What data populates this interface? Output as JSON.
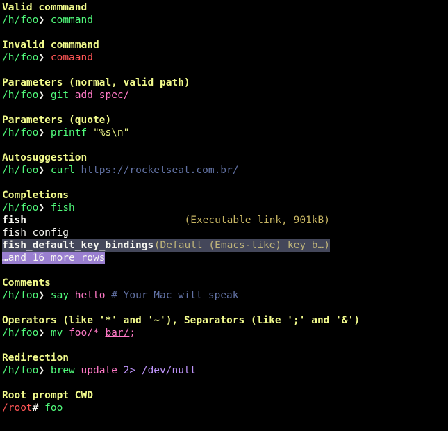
{
  "sections": {
    "valid": {
      "title": "Valid commmand",
      "cwd": "/h/foo",
      "prompt": "❯",
      "command": "command"
    },
    "invalid": {
      "title": "Invalid commmand",
      "cwd": "/h/foo",
      "prompt": "❯",
      "command": "comaand"
    },
    "params": {
      "title": "Parameters (normal, valid path)",
      "cwd": "/h/foo",
      "prompt": "❯",
      "command": "git",
      "arg1": "add",
      "path": "spec/"
    },
    "quote": {
      "title": "Parameters (quote)",
      "cwd": "/h/foo",
      "prompt": "❯",
      "command": "printf",
      "arg": "\"%s\\n\""
    },
    "autosuggestion": {
      "title": "Autosuggestion",
      "cwd": "/h/foo",
      "prompt": "❯",
      "command": "curl",
      "suggestion": "https://rocketseat.com.br/"
    },
    "completions": {
      "title": "Completions",
      "cwd": "/h/foo",
      "prompt": "❯",
      "command": "fish",
      "items": [
        {
          "name": "fish",
          "desc": "(Executable link, 901kB)"
        },
        {
          "name": "fish_config",
          "desc": ""
        },
        {
          "name": "fish_default_key_bindings",
          "desc": "(Default (Emacs-like) key b…)"
        }
      ],
      "more": "…and 16 more rows"
    },
    "comments": {
      "title": "Comments",
      "cwd": "/h/foo",
      "prompt": "❯",
      "command": "say",
      "arg": "hello",
      "comment": "# Your Mac will speak"
    },
    "operators": {
      "title": "Operators (like '*' and '~'), Separators (like ';' and '&')",
      "cwd": "/h/foo",
      "prompt": "❯",
      "command": "mv",
      "arg": "foo/",
      "op": "*",
      "path": "bar/",
      "sep": ";"
    },
    "redirection": {
      "title": "Redirection",
      "cwd": "/h/foo",
      "prompt": "❯",
      "command": "brew",
      "arg": "update",
      "redirect": "2>",
      "target": "/dev/null"
    },
    "root": {
      "title": "Root prompt CWD",
      "cwd": "/root",
      "prompt": "#",
      "command": "foo"
    }
  },
  "colors": {
    "background": "#000000",
    "title": "#f1fa8c",
    "cwd": "#50fa7b",
    "error": "#ff5555",
    "param": "#ff79c6",
    "comment": "#6272a4",
    "redirect": "#bd93f9",
    "selection": "#44475a",
    "more_rows_bg": "#9a7fd0"
  }
}
